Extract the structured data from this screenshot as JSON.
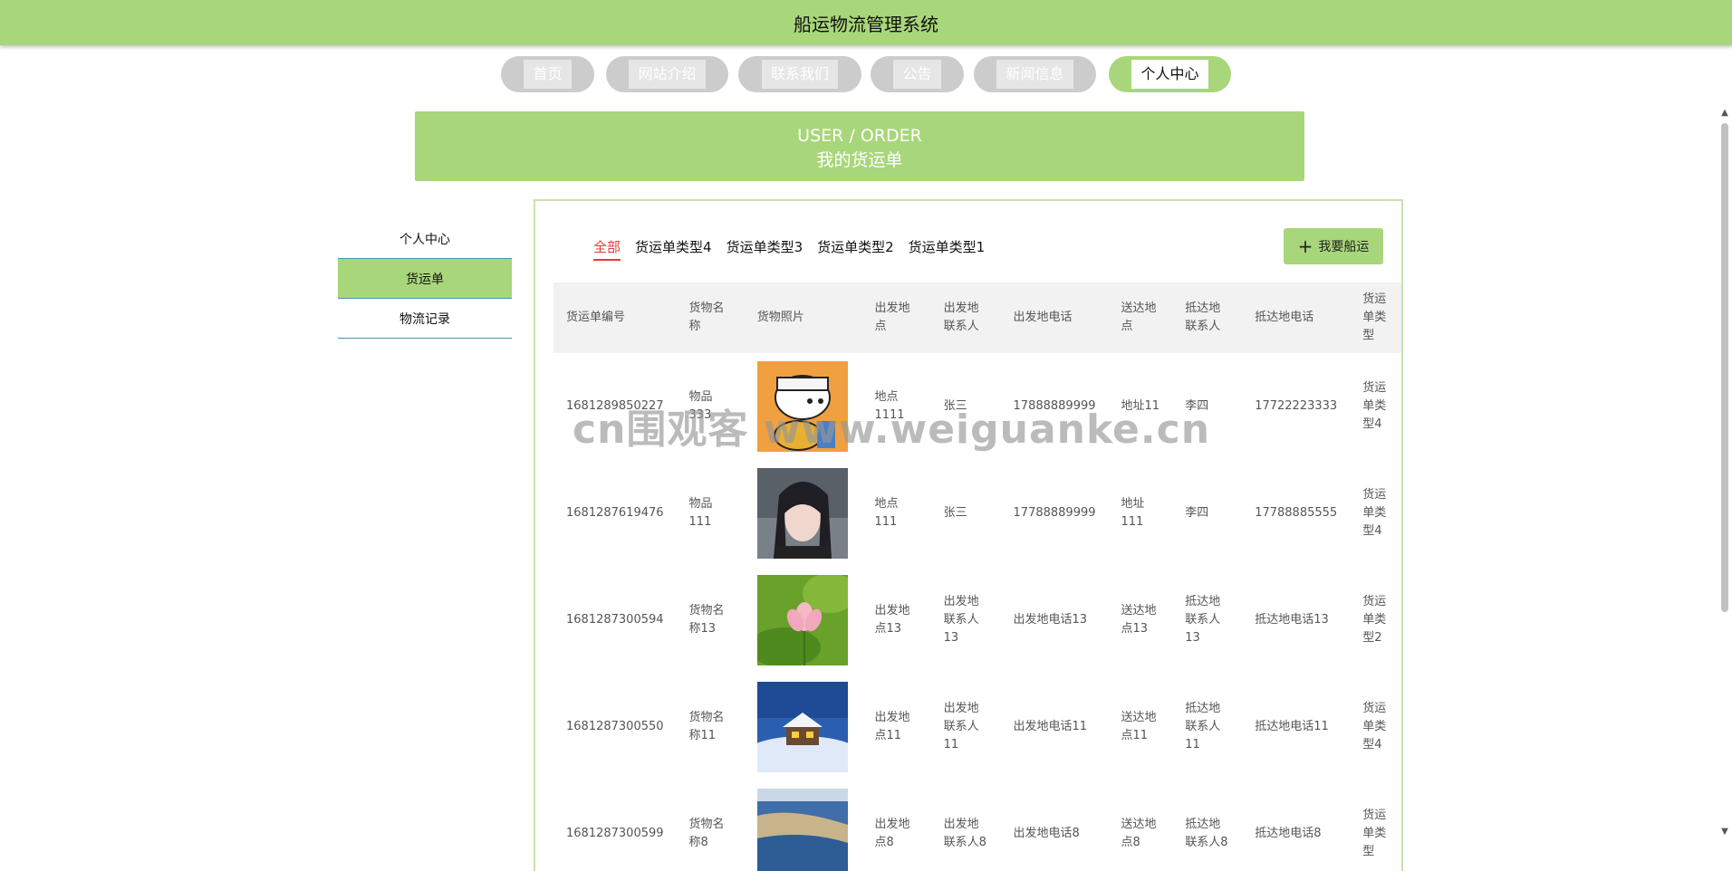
{
  "app": {
    "title": "船运物流管理系统"
  },
  "nav": {
    "items": [
      {
        "label": "首页"
      },
      {
        "label": "网站介绍"
      },
      {
        "label": "联系我们"
      },
      {
        "label": "公告"
      },
      {
        "label": "新闻信息"
      },
      {
        "label": "个人中心"
      }
    ]
  },
  "banner": {
    "en": "USER / ORDER",
    "cn": "我的货运单"
  },
  "sidebar": {
    "items": [
      {
        "label": "个人中心"
      },
      {
        "label": "货运单"
      },
      {
        "label": "物流记录"
      }
    ]
  },
  "tabs": [
    {
      "label": "全部"
    },
    {
      "label": "货运单类型4"
    },
    {
      "label": "货运单类型3"
    },
    {
      "label": "货运单类型2"
    },
    {
      "label": "货运单类型1"
    }
  ],
  "action_button": {
    "label": "我要船运"
  },
  "table": {
    "headers": [
      "货运单编号",
      "货物名称",
      "货物照片",
      "出发地点",
      "出发地联系人",
      "出发地电话",
      "送达地点",
      "抵达地联系人",
      "抵达地电话",
      "货运单类型"
    ],
    "rows": [
      {
        "id": "1681289850227",
        "name": "物品333",
        "from": "地点1111",
        "from_contact": "张三",
        "from_phone": "17888889999",
        "to": "地址11",
        "to_contact": "李四",
        "to_phone": "17722223333",
        "type": "货运单类型4"
      },
      {
        "id": "1681287619476",
        "name": "物品111",
        "from": "地点111",
        "from_contact": "张三",
        "from_phone": "17788889999",
        "to": "地址111",
        "to_contact": "李四",
        "to_phone": "17788885555",
        "type": "货运单类型4"
      },
      {
        "id": "1681287300594",
        "name": "货物名称13",
        "from": "出发地点13",
        "from_contact": "出发地联系人13",
        "from_phone": "出发地电话13",
        "to": "送达地点13",
        "to_contact": "抵达地联系人13",
        "to_phone": "抵达地电话13",
        "type": "货运单类型2"
      },
      {
        "id": "1681287300550",
        "name": "货物名称11",
        "from": "出发地点11",
        "from_contact": "出发地联系人11",
        "from_phone": "出发地电话11",
        "to": "送达地点11",
        "to_contact": "抵达地联系人11",
        "to_phone": "抵达地电话11",
        "type": "货运单类型4"
      },
      {
        "id": "1681287300599",
        "name": "货物名称8",
        "from": "出发地点8",
        "from_contact": "出发地联系人8",
        "from_phone": "出发地电话8",
        "to": "送达地点8",
        "to_contact": "抵达地联系人8",
        "to_phone": "抵达地电话8",
        "type": "货运单类型"
      }
    ]
  },
  "watermark": "cn围观客 www.weiguanke.cn",
  "colors": {
    "accent": "#a8d67a",
    "active_tab": "#e53935",
    "nav_inactive": "#cccccc"
  }
}
